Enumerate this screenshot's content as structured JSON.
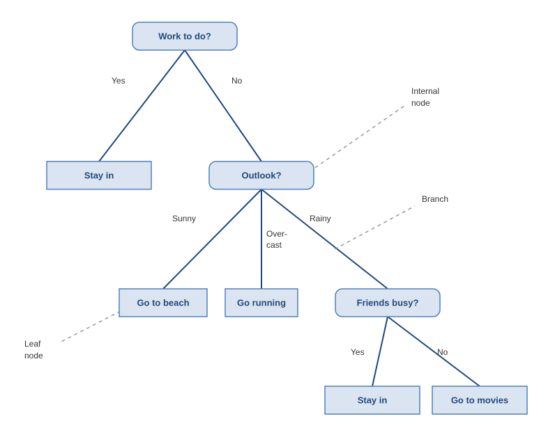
{
  "nodes": {
    "root": {
      "label": "Work to do?"
    },
    "stayin1": {
      "label": "Stay in"
    },
    "outlook": {
      "label": "Outlook?"
    },
    "beach": {
      "label": "Go to beach"
    },
    "running": {
      "label": "Go running"
    },
    "friends": {
      "label": "Friends busy?"
    },
    "stayin2": {
      "label": "Stay in"
    },
    "movies": {
      "label": "Go to movies"
    }
  },
  "edges": {
    "root_yes": {
      "label": "Yes"
    },
    "root_no": {
      "label": "No"
    },
    "outlook_sunny": {
      "label": "Sunny"
    },
    "outlook_over1": {
      "label": "Over-"
    },
    "outlook_over2": {
      "label": "cast"
    },
    "outlook_rainy": {
      "label": "Rainy"
    },
    "friends_yes": {
      "label": "Yes"
    },
    "friends_no": {
      "label": "No"
    }
  },
  "annotations": {
    "internal1": {
      "label": "Internal"
    },
    "internal2": {
      "label": "node"
    },
    "branch": {
      "label": "Branch"
    },
    "leaf1": {
      "label": "Leaf"
    },
    "leaf2": {
      "label": "node"
    }
  }
}
